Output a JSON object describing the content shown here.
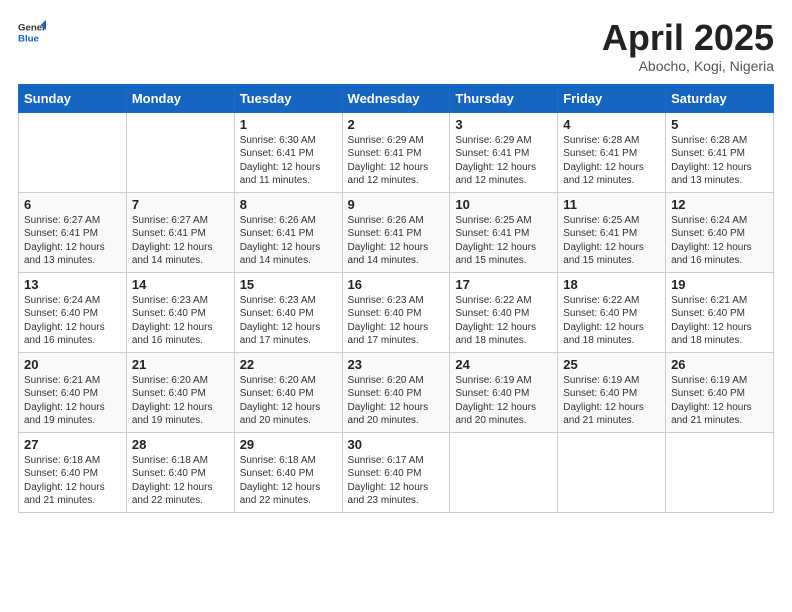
{
  "logo": {
    "general": "General",
    "blue": "Blue"
  },
  "title": {
    "month_year": "April 2025",
    "location": "Abocho, Kogi, Nigeria"
  },
  "weekdays": [
    "Sunday",
    "Monday",
    "Tuesday",
    "Wednesday",
    "Thursday",
    "Friday",
    "Saturday"
  ],
  "weeks": [
    [
      {
        "day": null,
        "info": null
      },
      {
        "day": null,
        "info": null
      },
      {
        "day": "1",
        "info": "Sunrise: 6:30 AM\nSunset: 6:41 PM\nDaylight: 12 hours and 11 minutes."
      },
      {
        "day": "2",
        "info": "Sunrise: 6:29 AM\nSunset: 6:41 PM\nDaylight: 12 hours and 12 minutes."
      },
      {
        "day": "3",
        "info": "Sunrise: 6:29 AM\nSunset: 6:41 PM\nDaylight: 12 hours and 12 minutes."
      },
      {
        "day": "4",
        "info": "Sunrise: 6:28 AM\nSunset: 6:41 PM\nDaylight: 12 hours and 12 minutes."
      },
      {
        "day": "5",
        "info": "Sunrise: 6:28 AM\nSunset: 6:41 PM\nDaylight: 12 hours and 13 minutes."
      }
    ],
    [
      {
        "day": "6",
        "info": "Sunrise: 6:27 AM\nSunset: 6:41 PM\nDaylight: 12 hours and 13 minutes."
      },
      {
        "day": "7",
        "info": "Sunrise: 6:27 AM\nSunset: 6:41 PM\nDaylight: 12 hours and 14 minutes."
      },
      {
        "day": "8",
        "info": "Sunrise: 6:26 AM\nSunset: 6:41 PM\nDaylight: 12 hours and 14 minutes."
      },
      {
        "day": "9",
        "info": "Sunrise: 6:26 AM\nSunset: 6:41 PM\nDaylight: 12 hours and 14 minutes."
      },
      {
        "day": "10",
        "info": "Sunrise: 6:25 AM\nSunset: 6:41 PM\nDaylight: 12 hours and 15 minutes."
      },
      {
        "day": "11",
        "info": "Sunrise: 6:25 AM\nSunset: 6:41 PM\nDaylight: 12 hours and 15 minutes."
      },
      {
        "day": "12",
        "info": "Sunrise: 6:24 AM\nSunset: 6:40 PM\nDaylight: 12 hours and 16 minutes."
      }
    ],
    [
      {
        "day": "13",
        "info": "Sunrise: 6:24 AM\nSunset: 6:40 PM\nDaylight: 12 hours and 16 minutes."
      },
      {
        "day": "14",
        "info": "Sunrise: 6:23 AM\nSunset: 6:40 PM\nDaylight: 12 hours and 16 minutes."
      },
      {
        "day": "15",
        "info": "Sunrise: 6:23 AM\nSunset: 6:40 PM\nDaylight: 12 hours and 17 minutes."
      },
      {
        "day": "16",
        "info": "Sunrise: 6:23 AM\nSunset: 6:40 PM\nDaylight: 12 hours and 17 minutes."
      },
      {
        "day": "17",
        "info": "Sunrise: 6:22 AM\nSunset: 6:40 PM\nDaylight: 12 hours and 18 minutes."
      },
      {
        "day": "18",
        "info": "Sunrise: 6:22 AM\nSunset: 6:40 PM\nDaylight: 12 hours and 18 minutes."
      },
      {
        "day": "19",
        "info": "Sunrise: 6:21 AM\nSunset: 6:40 PM\nDaylight: 12 hours and 18 minutes."
      }
    ],
    [
      {
        "day": "20",
        "info": "Sunrise: 6:21 AM\nSunset: 6:40 PM\nDaylight: 12 hours and 19 minutes."
      },
      {
        "day": "21",
        "info": "Sunrise: 6:20 AM\nSunset: 6:40 PM\nDaylight: 12 hours and 19 minutes."
      },
      {
        "day": "22",
        "info": "Sunrise: 6:20 AM\nSunset: 6:40 PM\nDaylight: 12 hours and 20 minutes."
      },
      {
        "day": "23",
        "info": "Sunrise: 6:20 AM\nSunset: 6:40 PM\nDaylight: 12 hours and 20 minutes."
      },
      {
        "day": "24",
        "info": "Sunrise: 6:19 AM\nSunset: 6:40 PM\nDaylight: 12 hours and 20 minutes."
      },
      {
        "day": "25",
        "info": "Sunrise: 6:19 AM\nSunset: 6:40 PM\nDaylight: 12 hours and 21 minutes."
      },
      {
        "day": "26",
        "info": "Sunrise: 6:19 AM\nSunset: 6:40 PM\nDaylight: 12 hours and 21 minutes."
      }
    ],
    [
      {
        "day": "27",
        "info": "Sunrise: 6:18 AM\nSunset: 6:40 PM\nDaylight: 12 hours and 21 minutes."
      },
      {
        "day": "28",
        "info": "Sunrise: 6:18 AM\nSunset: 6:40 PM\nDaylight: 12 hours and 22 minutes."
      },
      {
        "day": "29",
        "info": "Sunrise: 6:18 AM\nSunset: 6:40 PM\nDaylight: 12 hours and 22 minutes."
      },
      {
        "day": "30",
        "info": "Sunrise: 6:17 AM\nSunset: 6:40 PM\nDaylight: 12 hours and 23 minutes."
      },
      {
        "day": null,
        "info": null
      },
      {
        "day": null,
        "info": null
      },
      {
        "day": null,
        "info": null
      }
    ]
  ]
}
